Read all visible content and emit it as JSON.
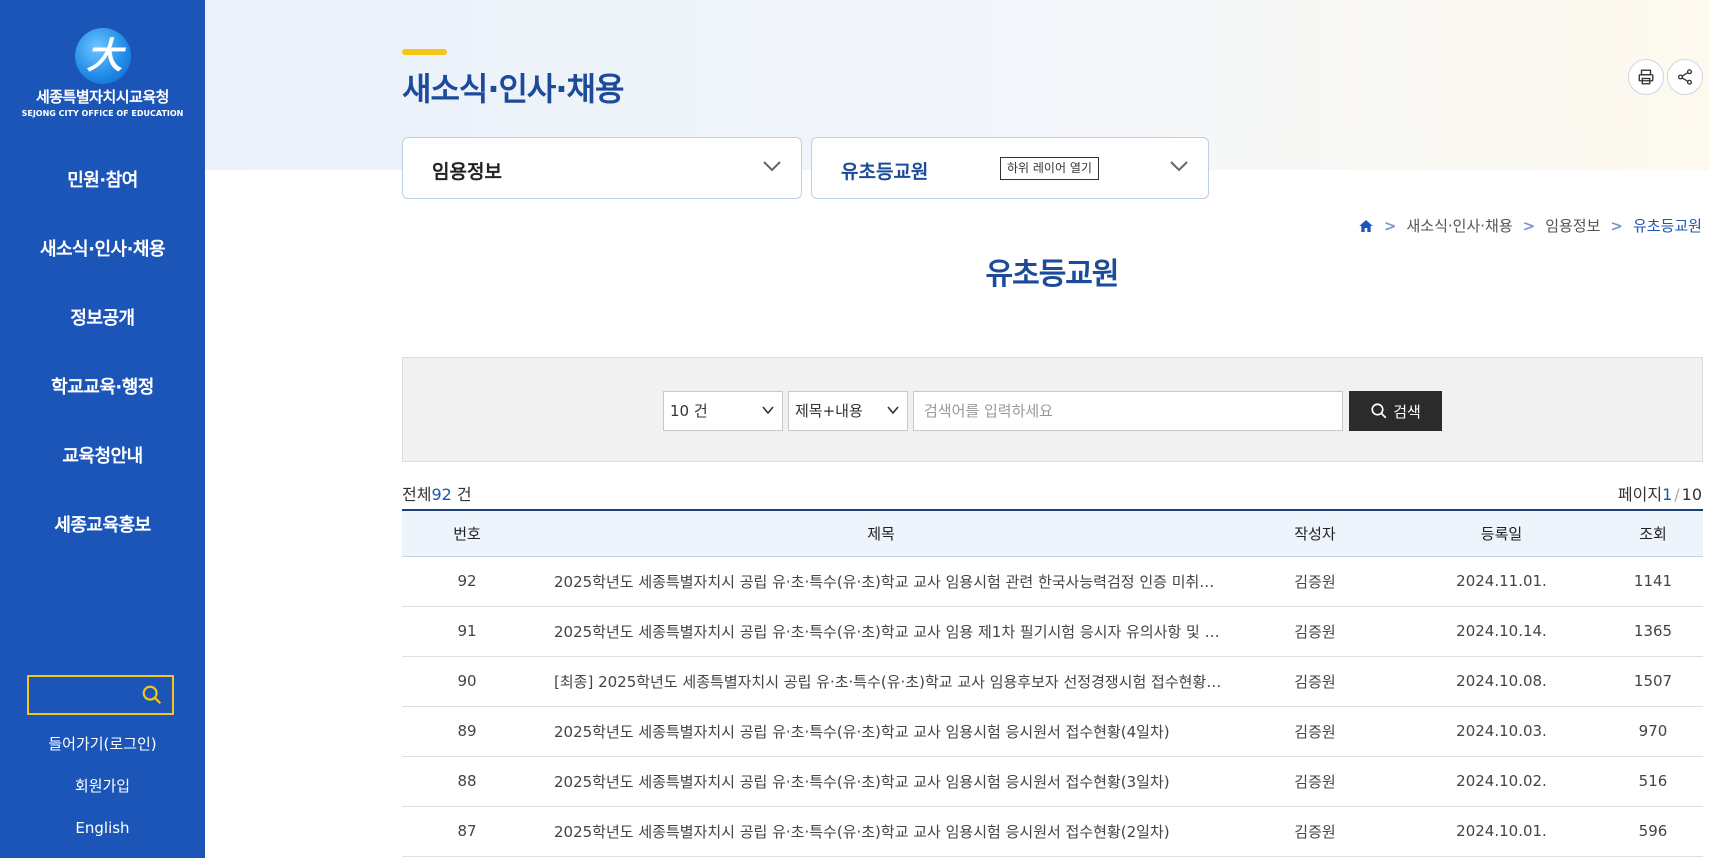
{
  "sidebar": {
    "logo_kor": "세종특별자치시교육청",
    "logo_eng": "SEJONG CITY OFFICE OF EDUCATION",
    "nav": [
      "민원·참여",
      "새소식·인사·채용",
      "정보공개",
      "학교교육·행정",
      "교육청안내",
      "세종교육홍보"
    ],
    "links": {
      "login": "들어가기(로그인)",
      "join": "회원가입",
      "english": "English"
    },
    "search_icon": "search-icon"
  },
  "header": {
    "title": "새소식·인사·채용",
    "utilities": [
      "print-icon",
      "share-icon"
    ]
  },
  "dropdowns": {
    "first": "임용정보",
    "second": "유초등교원",
    "layer_badge": "하위 레이어 열기"
  },
  "breadcrumb": {
    "items": [
      "새소식·인사·채용",
      "임용정보",
      "유초등교원"
    ]
  },
  "section_title": "유초등교원",
  "search": {
    "count_select": "10 건",
    "field_select": "제목+내용",
    "placeholder": "검색어를 입력하세요",
    "button": "검색"
  },
  "summary": {
    "total_prefix": "전체",
    "total_count": "92",
    "total_suffix": " 건",
    "page_prefix": "페이지",
    "page_current": "1",
    "page_sep": "/",
    "page_total": "10"
  },
  "table": {
    "headers": [
      "번호",
      "제목",
      "작성자",
      "등록일",
      "조회"
    ],
    "rows": [
      [
        "92",
        "2025학년도 세종특별자치시 공립 유·초·특수(유·초)학교 교사 임용시험 관련 한국사능력검정 인증 미취…",
        "김증원",
        "2024.11.01.",
        "1141"
      ],
      [
        "91",
        "2025학년도 세종특별자치시 공립 유·초·특수(유·초)학교 교사 임용 제1차 필기시험 응시자 유의사항 및 …",
        "김증원",
        "2024.10.14.",
        "1365"
      ],
      [
        "90",
        "[최종] 2025학년도 세종특별자치시 공립 유·초·특수(유·초)학교 교사 임용후보자 선정경쟁시험 접수현황…",
        "김증원",
        "2024.10.08.",
        "1507"
      ],
      [
        "89",
        "2025학년도 세종특별자치시 공립 유·초·특수(유·초)학교 교사 임용시험 응시원서 접수현황(4일차)",
        "김증원",
        "2024.10.03.",
        "970"
      ],
      [
        "88",
        "2025학년도 세종특별자치시 공립 유·초·특수(유·초)학교 교사 임용시험 응시원서 접수현황(3일차)",
        "김증원",
        "2024.10.02.",
        "516"
      ],
      [
        "87",
        "2025학년도 세종특별자치시 공립 유·초·특수(유·초)학교 교사 임용시험 응시원서 접수현황(2일차)",
        "김증원",
        "2024.10.01.",
        "596"
      ]
    ]
  },
  "colors": {
    "sidebar": "#1c55b8",
    "accent_yellow": "#f5c518",
    "title_blue": "#1c4b9a",
    "button_dark": "#2b2b2b"
  }
}
